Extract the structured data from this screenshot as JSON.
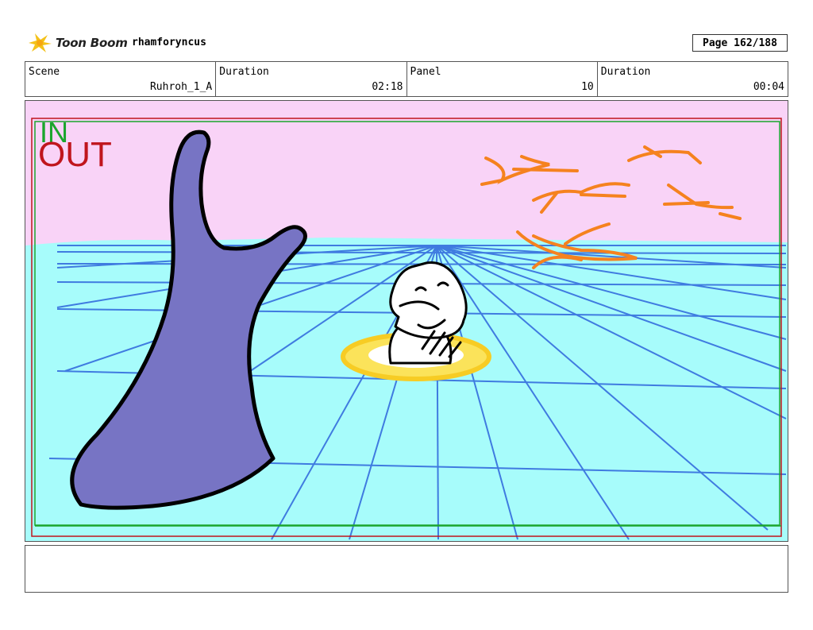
{
  "header": {
    "brand": "Toon Boom",
    "project": "rhamforyncus",
    "page": "Page 162/188"
  },
  "info": {
    "scene_label": "Scene",
    "scene_value": "Ruhroh_1_A",
    "scene_duration_label": "Duration",
    "scene_duration_value": "02:18",
    "panel_label": "Panel",
    "panel_value": "10",
    "panel_duration_label": "Duration",
    "panel_duration_value": "00:04"
  },
  "frame": {
    "in_label": "IN",
    "out_label": "OUT"
  },
  "colors": {
    "sky": "#f9d3f7",
    "sea": "#a7fcfb",
    "grid": "#3f7be0",
    "whale": "#7774c4",
    "birds": "#f5821f",
    "float": "#f7cc24",
    "in_green": "#1aa52c",
    "out_red": "#c0151d"
  },
  "notes": ""
}
